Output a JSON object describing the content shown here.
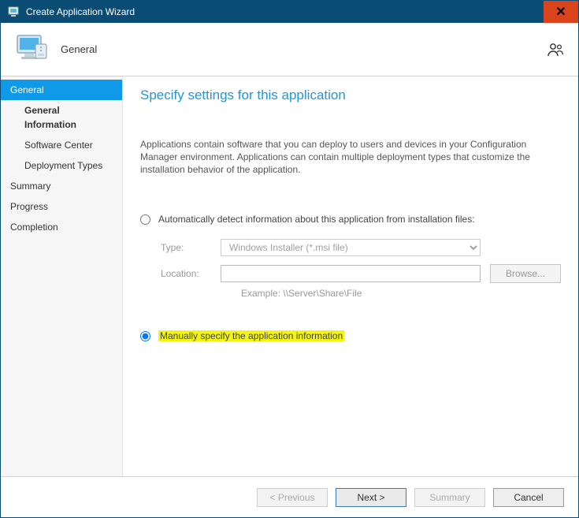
{
  "titlebar": {
    "title": "Create Application Wizard"
  },
  "header": {
    "heading": "General"
  },
  "sidebar": {
    "general": "General",
    "general_info": "General Information",
    "software_center": "Software Center",
    "deployment_types": "Deployment Types",
    "summary": "Summary",
    "progress": "Progress",
    "completion": "Completion"
  },
  "content": {
    "title": "Specify settings for this application",
    "intro": "Applications contain software that you can deploy to users and devices in your Configuration Manager environment. Applications can contain multiple deployment types that customize the installation behavior of the application.",
    "radio_auto": "Automatically detect information about this application from installation files:",
    "radio_manual": "Manually specify the application information",
    "type_label": "Type:",
    "type_value": "Windows Installer (*.msi file)",
    "location_label": "Location:",
    "location_value": "",
    "example": "Example: \\\\Server\\Share\\File",
    "browse": "Browse..."
  },
  "footer": {
    "previous": "< Previous",
    "next": "Next >",
    "summary": "Summary",
    "cancel": "Cancel"
  }
}
